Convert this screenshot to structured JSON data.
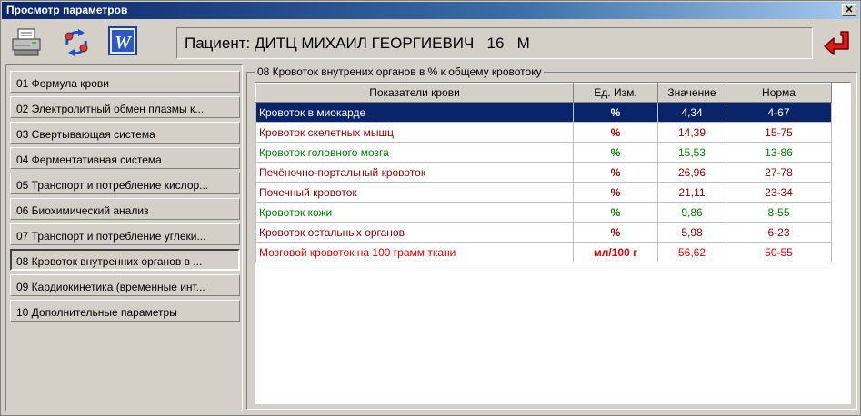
{
  "window": {
    "title": "Просмотр параметров",
    "close_label": "✕"
  },
  "toolbar": {
    "print_icon": "printer-icon",
    "refresh_icon": "refresh-icon",
    "word_icon": "word-icon",
    "word_letter": "W",
    "back_icon": "back-arrow-icon"
  },
  "patient": {
    "label": "Пациент:",
    "name": "ДИТЦ МИХАИЛ ГЕОРГИЕВИЧ",
    "age": "16",
    "sex": "М"
  },
  "sidebar": {
    "items": [
      {
        "label": "01 Формула крови"
      },
      {
        "label": "02 Электролитный обмен плазмы к..."
      },
      {
        "label": "03 Свертывающая система"
      },
      {
        "label": "04 Ферментативная система"
      },
      {
        "label": "05 Транспорт и потребление кислор..."
      },
      {
        "label": "06 Биохимический анализ"
      },
      {
        "label": "07 Транспорт и потребление углеки..."
      },
      {
        "label": "08 Кровоток внутренних органов в ..."
      },
      {
        "label": "09 Кардиокинетика (временные инт..."
      },
      {
        "label": "10 Дополнительные параметры"
      }
    ],
    "active_index": 7
  },
  "group": {
    "title": "08 Кровоток внутрених органов в % к общему кровотоку"
  },
  "table": {
    "columns": [
      "Показатели крови",
      "Ед. Изм.",
      "Значение",
      "Норма"
    ],
    "rows": [
      {
        "name": "Кровоток в миокарде",
        "unit": "%",
        "value": "4,34",
        "norm": "4-67",
        "color": "#0a246a"
      },
      {
        "name": "Кровоток скелетных мышц",
        "unit": "%",
        "value": "14,39",
        "norm": "15-75",
        "color": "#8b0000"
      },
      {
        "name": "Кровоток головного мозга",
        "unit": "%",
        "value": "15,53",
        "norm": "13-86",
        "color": "#008000"
      },
      {
        "name": "Печёночно-портальный кровоток",
        "unit": "%",
        "value": "26,96",
        "norm": "27-78",
        "color": "#8b0000"
      },
      {
        "name": "Почечный кровоток",
        "unit": "%",
        "value": "21,11",
        "norm": "23-34",
        "color": "#8b0000"
      },
      {
        "name": "Кровоток кожи",
        "unit": "%",
        "value": "9,86",
        "norm": "8-55",
        "color": "#008000"
      },
      {
        "name": "Кровоток остальных органов",
        "unit": "%",
        "value": "5,98",
        "norm": "6-23",
        "color": "#8b0000"
      },
      {
        "name": "Мозговой кровоток на 100 грамм ткани",
        "unit": "мл/100 г",
        "value": "56,62",
        "norm": "50-55",
        "color": "#e00000"
      }
    ],
    "selected_index": 0
  }
}
